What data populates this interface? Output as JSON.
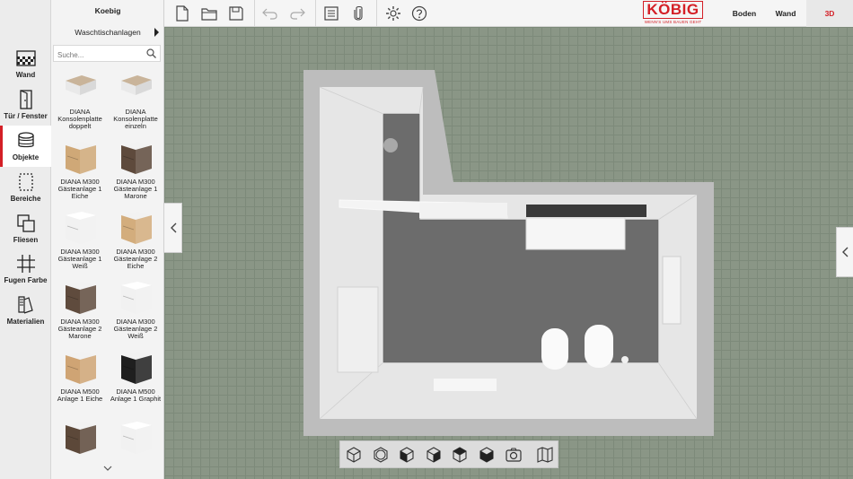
{
  "rail": {
    "items": [
      {
        "label": "Wand",
        "icon": "wall-texture-icon"
      },
      {
        "label": "Tür / Fenster",
        "icon": "door-icon"
      },
      {
        "label": "Objekte",
        "icon": "objects-stack-icon"
      },
      {
        "label": "Bereiche",
        "icon": "area-select-icon"
      },
      {
        "label": "Fliesen",
        "icon": "tiles-icon"
      },
      {
        "label": "Fugen Farbe",
        "icon": "grout-grid-icon"
      },
      {
        "label": "Materialien",
        "icon": "materials-swatch-icon"
      }
    ],
    "active": "Objekte"
  },
  "panel": {
    "title": "Koebig",
    "category": "Waschtischanlagen",
    "search_placeholder": "Suche...",
    "products": [
      {
        "name": "DIANA Konsolenplatte doppelt",
        "tone": "#e9e9e9",
        "top": "#c9b49a"
      },
      {
        "name": "DIANA Konsolenplatte einzeln",
        "tone": "#e9e9e9",
        "top": "#c9b49a"
      },
      {
        "name": "DIANA M300 Gästeanlage 1 Eiche",
        "tone": "#cfa877",
        "top": "#f2f2f2"
      },
      {
        "name": "DIANA M300 Gästeanlage 1 Marone",
        "tone": "#5e4a3c",
        "top": "#f2f2f2"
      },
      {
        "name": "DIANA M300 Gästeanlage 1 Weiß",
        "tone": "#f1f1f1",
        "top": "#ffffff"
      },
      {
        "name": "DIANA M300 Gästeanlage 2 Eiche",
        "tone": "#d3ad7d",
        "top": "#f2f2f2"
      },
      {
        "name": "DIANA M300 Gästeanlage 2 Marone",
        "tone": "#5f4b3d",
        "top": "#f2f2f2"
      },
      {
        "name": "DIANA M300 Gästeanlage 2 Weiß",
        "tone": "#f1f1f1",
        "top": "#ffffff"
      },
      {
        "name": "DIANA M500 Anlage 1 Eiche",
        "tone": "#cfa474",
        "top": "#f2f2f2"
      },
      {
        "name": "DIANA M500 Anlage 1 Graphit",
        "tone": "#1f1f1f",
        "top": "#f2f2f2"
      },
      {
        "name": "",
        "tone": "#5c4839",
        "top": "#f2f2f2"
      },
      {
        "name": "",
        "tone": "#f1f1f1",
        "top": "#ffffff"
      }
    ]
  },
  "toolbar": {
    "buttons": [
      "new-file-icon",
      "open-folder-icon",
      "save-icon",
      "undo-icon",
      "redo-icon",
      "list-icon",
      "attach-icon",
      "settings-icon",
      "help-icon"
    ],
    "logo": {
      "mark": "KÖBIG",
      "tagline": "WENN'S UMS BAUEN GEHT"
    },
    "views": [
      "Boden",
      "Wand",
      "3D"
    ],
    "active_view": "3D"
  },
  "viewbar": {
    "buttons": [
      "cube-outline-icon",
      "cube-round-icon",
      "cube-left-icon",
      "cube-front-icon",
      "cube-right-icon",
      "cube-back-icon",
      "camera-icon",
      "map-icon"
    ]
  },
  "colors": {
    "accent": "#d41f26",
    "canvas": "#8a9686"
  }
}
